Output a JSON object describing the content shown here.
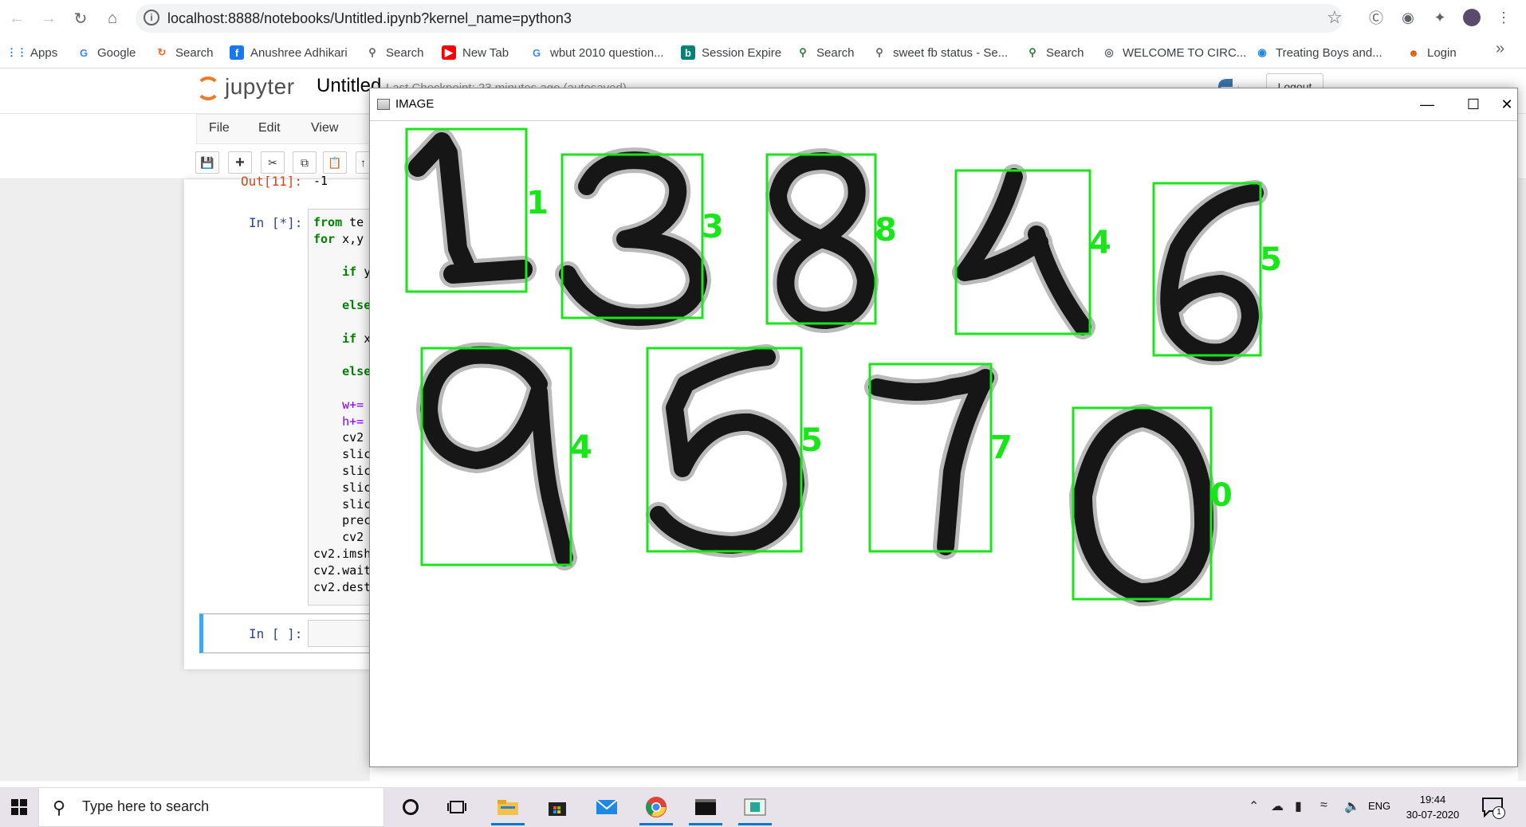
{
  "browser": {
    "url": "localhost:8888/notebooks/Untitled.ipynb?kernel_name=python3",
    "bookmarks": [
      {
        "label": "Apps",
        "icon": "apps-grid-icon",
        "color": "#1a73e8"
      },
      {
        "label": "Google",
        "icon": "google-icon",
        "color": "#4285f4"
      },
      {
        "label": "Search",
        "icon": "search-orange-icon",
        "color": "#f26522"
      },
      {
        "label": "Anushree Adhikari",
        "icon": "facebook-icon",
        "color": "#1877f2"
      },
      {
        "label": "Search",
        "icon": "search-key-icon",
        "color": "#5f6368"
      },
      {
        "label": "New Tab",
        "icon": "youtube-icon",
        "color": "#ff0000"
      },
      {
        "label": "wbut 2010 question...",
        "icon": "google-icon",
        "color": "#4285f4"
      },
      {
        "label": "Session Expire",
        "icon": "bing-icon",
        "color": "#008373"
      },
      {
        "label": "Search",
        "icon": "search-green-icon",
        "color": "#2e7d32"
      },
      {
        "label": "sweet fb status - Se...",
        "icon": "search-key-icon",
        "color": "#5f6368"
      },
      {
        "label": "Search",
        "icon": "search-green-icon",
        "color": "#2e7d32"
      },
      {
        "label": "WELCOME TO CIRC...",
        "icon": "globe-icon",
        "color": "#5f6368"
      },
      {
        "label": "Treating Boys and...",
        "icon": "shield-location-icon",
        "color": "#1e88e5"
      },
      {
        "label": "Login",
        "icon": "login-avatar-icon",
        "color": "#e65100"
      }
    ],
    "bookmarks_more": "»"
  },
  "jupyter": {
    "logo_text": "jupyter",
    "notebook_title": "Untitled",
    "checkpoint": "Last Checkpoint: 23 minutes ago  (autosaved)",
    "logout": "Logout",
    "menu": [
      "File",
      "Edit",
      "View"
    ],
    "out_prompt": "Out[11]:",
    "out_value": "-1",
    "in_prompt_running": "In [*]:",
    "in_prompt_empty": "In [ ]:",
    "code_lines": [
      {
        "kw": "from",
        "text": " te"
      },
      {
        "kw": "for",
        "text": " x,y"
      },
      {
        "kw": "",
        "text": ""
      },
      {
        "kw": "    if",
        "text": " y"
      },
      {
        "kw": "",
        "text": ""
      },
      {
        "kw": "    else",
        "text": ""
      },
      {
        "kw": "",
        "text": ""
      },
      {
        "kw": "    if",
        "text": " x"
      },
      {
        "kw": "",
        "text": ""
      },
      {
        "kw": "    else",
        "text": ""
      },
      {
        "kw": "",
        "text": ""
      },
      {
        "kw": "",
        "text": "    w+=",
        "var": true
      },
      {
        "kw": "",
        "text": "    h+=",
        "var": true
      },
      {
        "kw": "",
        "text": "    cv2"
      },
      {
        "kw": "",
        "text": "    slic"
      },
      {
        "kw": "",
        "text": "    slic"
      },
      {
        "kw": "",
        "text": "    slic"
      },
      {
        "kw": "",
        "text": "    slic"
      },
      {
        "kw": "",
        "text": "    prec"
      },
      {
        "kw": "",
        "text": "    cv2"
      },
      {
        "kw": "",
        "text": "cv2.imsh"
      },
      {
        "kw": "",
        "text": "cv2.wait"
      },
      {
        "kw": "",
        "text": "cv2.dest"
      }
    ]
  },
  "cv_window": {
    "title": "IMAGE",
    "controls": {
      "minimize": "—",
      "maximize": "☐",
      "close": "✕"
    },
    "detections": [
      {
        "digit": "1",
        "prediction": "1"
      },
      {
        "digit": "3",
        "prediction": "3"
      },
      {
        "digit": "8",
        "prediction": "8"
      },
      {
        "digit": "4",
        "prediction": "4"
      },
      {
        "digit": "6",
        "prediction": "5"
      },
      {
        "digit": "9",
        "prediction": "4"
      },
      {
        "digit": "5",
        "prediction": "5"
      },
      {
        "digit": "7",
        "prediction": "7"
      },
      {
        "digit": "0",
        "prediction": "0"
      }
    ],
    "box_color": "#19e619"
  },
  "taskbar": {
    "search_placeholder": "Type here to search",
    "language": "ENG",
    "time": "19:44",
    "date": "30-07-2020",
    "notification_count": "1"
  }
}
